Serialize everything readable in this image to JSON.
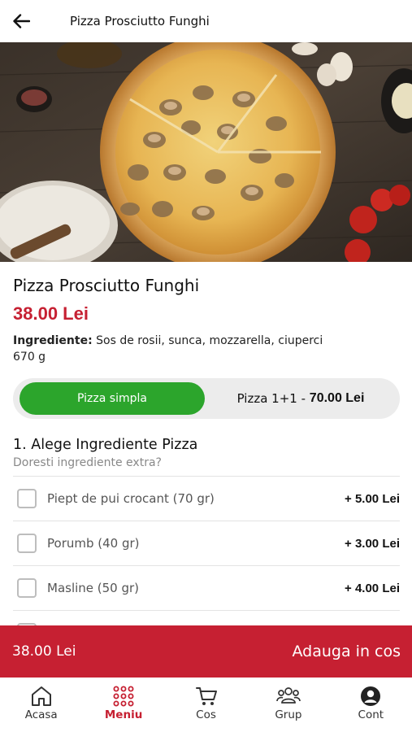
{
  "topbar": {
    "title": "Pizza Prosciutto Funghi"
  },
  "product": {
    "title": "Pizza Prosciutto Funghi",
    "price": "38.00 Lei",
    "ingredients_label": "Ingrediente:",
    "ingredients_text": "Sos de rosii, sunca, mozzarella, ciuperci",
    "weight": "670 g"
  },
  "variant": {
    "simple_label": "Pizza simpla",
    "double_label": "Pizza 1+1 - ",
    "double_price": "70.00 Lei"
  },
  "section": {
    "title": "1. Alege Ingrediente Pizza",
    "subtitle": "Doresti ingrediente extra?"
  },
  "options": [
    {
      "label": "Piept de pui crocant (70 gr)",
      "price": "+ 5.00 Lei"
    },
    {
      "label": "Porumb (40 gr)",
      "price": "+ 3.00 Lei"
    },
    {
      "label": "Masline (50 gr)",
      "price": "+ 4.00 Lei"
    }
  ],
  "cart": {
    "total": "38.00 Lei",
    "add_label": "Adauga in cos"
  },
  "nav": [
    {
      "label": "Acasa",
      "icon": "home-icon"
    },
    {
      "label": "Meniu",
      "icon": "menu-grid-icon"
    },
    {
      "label": "Cos",
      "icon": "cart-icon"
    },
    {
      "label": "Grup",
      "icon": "group-icon"
    },
    {
      "label": "Cont",
      "icon": "account-icon"
    }
  ],
  "colors": {
    "brand": "#c62032",
    "accent_green": "#2ca52c"
  }
}
